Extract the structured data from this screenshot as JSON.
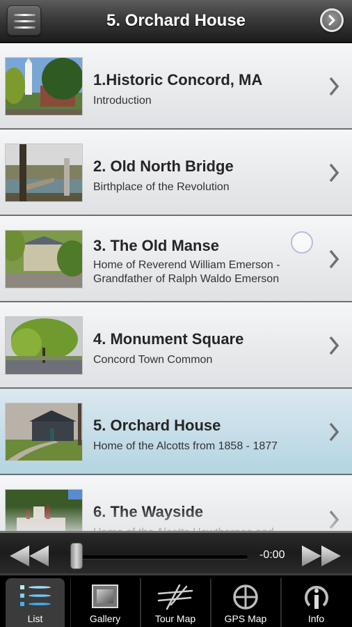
{
  "header": {
    "title": "5. Orchard House",
    "menu_icon": "hamburger-menu-icon",
    "next_icon": "circle-chevron-right-icon"
  },
  "list": {
    "items": [
      {
        "title": "1.Historic Concord, MA",
        "subtitle": "Introduction",
        "selected": false
      },
      {
        "title": "2. Old North Bridge",
        "subtitle": "Birthplace of the Revolution",
        "selected": false
      },
      {
        "title": "3. The Old Manse",
        "subtitle": "Home of Reverend William Emerson - Grandfather of Ralph Waldo Emerson",
        "selected": false
      },
      {
        "title": "4. Monument Square",
        "subtitle": "Concord Town Common",
        "selected": false
      },
      {
        "title": "5. Orchard House",
        "subtitle": "Home of the Alcotts from 1858 - 1877",
        "selected": true
      },
      {
        "title": "6. The Wayside",
        "subtitle": "Home of the Alcotts Hawthornes and",
        "selected": false
      }
    ],
    "selected_color": "#c5dde8"
  },
  "player": {
    "time": "-0:00",
    "progress": 0,
    "rewind_icon": "rewind-icon",
    "forward_icon": "fast-forward-icon"
  },
  "tabs": [
    {
      "label": "List",
      "icon": "list-icon",
      "active": true
    },
    {
      "label": "Gallery",
      "icon": "gallery-icon",
      "active": false
    },
    {
      "label": "Tour Map",
      "icon": "tour-map-icon",
      "active": false
    },
    {
      "label": "GPS Map",
      "icon": "gps-crosshair-icon",
      "active": false
    },
    {
      "label": "Info",
      "icon": "info-icon",
      "active": false
    }
  ]
}
